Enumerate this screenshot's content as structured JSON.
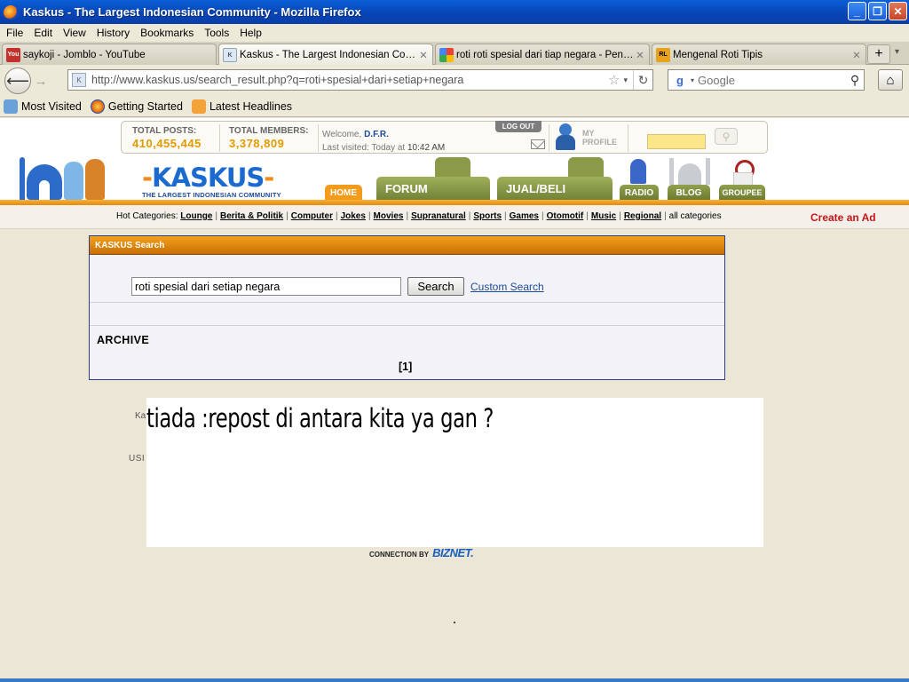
{
  "window": {
    "title": "Kaskus - The Largest Indonesian Community - Mozilla Firefox",
    "controls": [
      "_",
      "❐",
      "✕"
    ]
  },
  "menu": [
    "File",
    "Edit",
    "View",
    "History",
    "Bookmarks",
    "Tools",
    "Help"
  ],
  "tabs": [
    {
      "label": "saykoji - Jomblo - YouTube",
      "favicon": "youtube-icon",
      "active": false
    },
    {
      "label": "Kaskus - The Largest Indonesian Comm...",
      "favicon": "kaskus-icon",
      "active": true
    },
    {
      "label": "roti roti spesial dari tiap negara - Penelu...",
      "favicon": "google-icon",
      "active": false
    },
    {
      "label": "Mengenal Roti Tipis",
      "favicon": "blog-icon",
      "active": false
    }
  ],
  "address": {
    "url": "http://www.kaskus.us/search_result.php?q=roti+spesial+dari+setiap+negara",
    "search_placeholder": "Google"
  },
  "bookmarks": [
    {
      "label": "Most Visited",
      "icon": "most-visited-icon"
    },
    {
      "label": "Getting Started",
      "icon": "firefox-icon"
    },
    {
      "label": "Latest Headlines",
      "icon": "rss-icon"
    }
  ],
  "header": {
    "total_posts_label": "TOTAL POSTS:",
    "total_posts": "410,455,445",
    "total_members_label": "TOTAL MEMBERS:",
    "total_members": "3,378,809",
    "welcome_prefix": "Welcome,",
    "username": "D.F.R.",
    "last_visited_prefix": "Last visited: Today at",
    "last_visited_time": "10:42 AM",
    "logout": "LOG OUT",
    "my_profile_1": "MY",
    "my_profile_2": "PROFILE",
    "logo_word_a": "KAS",
    "logo_word_b": "KUS",
    "logo_tagline": "THE LARGEST INDONESIAN COMMUNITY",
    "nav": {
      "home": "HOME",
      "forum": "FORUM",
      "jual": "JUAL/BELI",
      "radio": "RADIO",
      "blog": "BLOG",
      "groupee": "GROUPEE"
    }
  },
  "hot_categories": {
    "label": "Hot Categories:",
    "items": [
      "Lounge",
      "Berita & Politik",
      "Computer",
      "Jokes",
      "Movies",
      "Supranatural",
      "Sports",
      "Games",
      "Otomotif",
      "Music",
      "Regional"
    ],
    "all": "all categories"
  },
  "create_ad": "Create an Ad",
  "search_panel": {
    "title": "KASKUS Search",
    "query": "roti spesial dari setiap negara",
    "button": "Search",
    "custom": "Custom Search",
    "archive": "ARCHIVE",
    "pager": "[1]"
  },
  "fragments": {
    "a": "Ka",
    "b": "USI"
  },
  "overlay_caption": "tiada :repost di antara kita ya gan ?",
  "connection": {
    "label": "CONNECTION BY",
    "brand": "BIZNET."
  }
}
